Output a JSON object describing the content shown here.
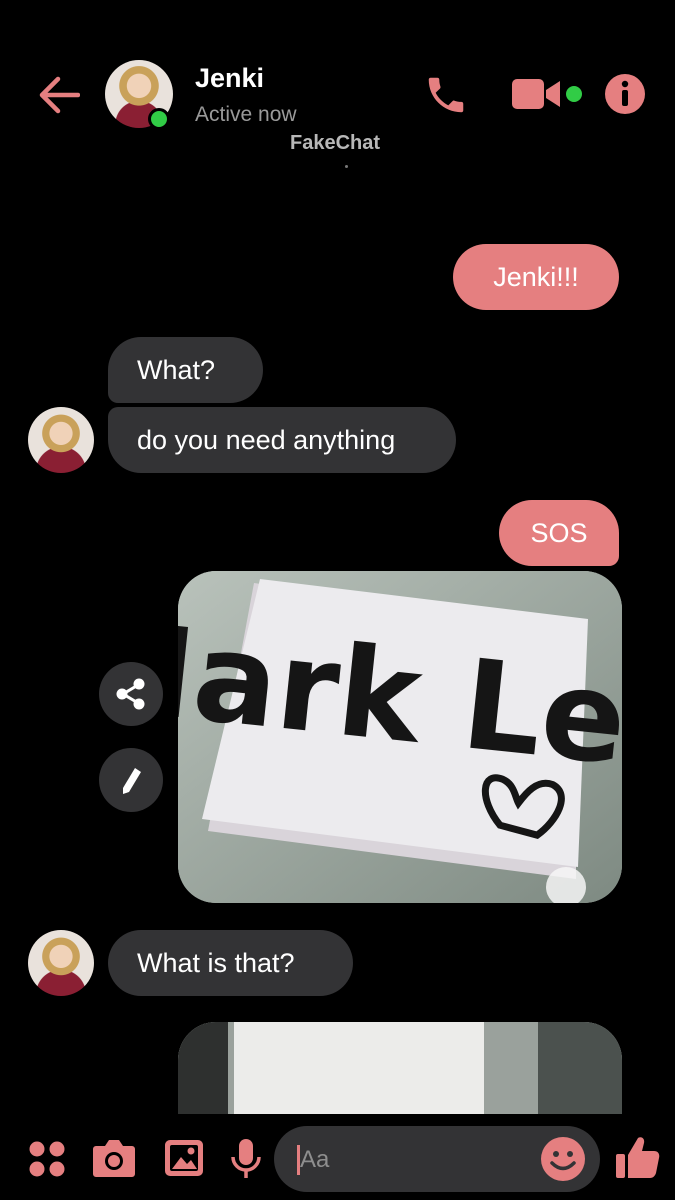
{
  "header": {
    "contact_name": "Jenki",
    "status": "Active now",
    "watermark": "FakeChat",
    "icons": [
      "back-arrow-icon",
      "phone-icon",
      "video-camera-icon",
      "info-icon"
    ],
    "accent_color": "#e57f80",
    "online_color": "#31cc46"
  },
  "messages": [
    {
      "direction": "out",
      "text": "Jenki!!!"
    },
    {
      "direction": "in",
      "text": "What?"
    },
    {
      "direction": "in",
      "text": "do you need anything"
    },
    {
      "direction": "out",
      "text": "SOS"
    },
    {
      "direction": "out",
      "type": "photo",
      "text": "Mark Lee"
    },
    {
      "direction": "in",
      "text": "What is that?"
    },
    {
      "direction": "out",
      "type": "photo",
      "text": ""
    }
  ],
  "photo_actions": [
    "share-icon",
    "pencil-icon"
  ],
  "composer": {
    "placeholder": "Aa",
    "icons": [
      "menu-dots-icon",
      "camera-icon",
      "gallery-icon",
      "microphone-icon",
      "emoji-icon",
      "thumbs-up-icon"
    ]
  }
}
